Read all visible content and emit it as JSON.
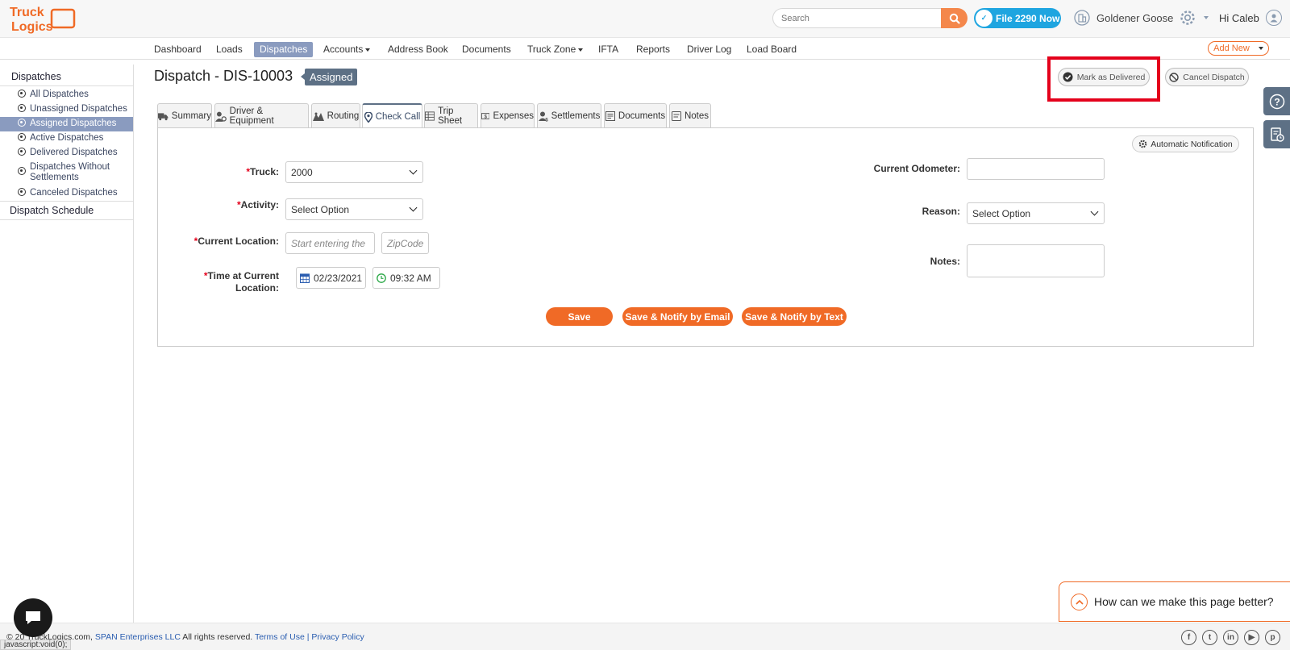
{
  "header": {
    "logo_text_1": "Truck",
    "logo_text_2": "Logics",
    "search_placeholder": "Search",
    "file_btn_label": "File 2290 Now",
    "file_btn_badge": "2290",
    "company_name": "Goldener Goose",
    "user_greeting": "Hi Caleb"
  },
  "nav": {
    "items": [
      {
        "label": "Dashboard"
      },
      {
        "label": "Loads"
      },
      {
        "label": "Dispatches"
      },
      {
        "label": "Accounts"
      },
      {
        "label": "Address Book"
      },
      {
        "label": "Documents"
      },
      {
        "label": "Truck Zone"
      },
      {
        "label": "IFTA"
      },
      {
        "label": "Reports"
      },
      {
        "label": "Driver Log"
      },
      {
        "label": "Load Board"
      }
    ],
    "add_new_label": "Add New"
  },
  "sidebar": {
    "heading": "Dispatches",
    "items": [
      {
        "label": "All Dispatches"
      },
      {
        "label": "Unassigned Dispatches"
      },
      {
        "label": "Assigned Dispatches"
      },
      {
        "label": "Active Dispatches"
      },
      {
        "label": "Delivered Dispatches"
      },
      {
        "label": "Dispatches Without Settlements"
      },
      {
        "label": "Canceled Dispatches"
      }
    ],
    "schedule_label": "Dispatch Schedule"
  },
  "page": {
    "title": "Dispatch - DIS-10003",
    "status": "Assigned",
    "mark_delivered_label": "Mark as Delivered",
    "cancel_dispatch_label": "Cancel Dispatch"
  },
  "tabs": [
    {
      "label": "Summary"
    },
    {
      "label": "Driver & Equipment"
    },
    {
      "label": "Routing"
    },
    {
      "label": "Check Call"
    },
    {
      "label": "Trip Sheet"
    },
    {
      "label": "Expenses"
    },
    {
      "label": "Settlements"
    },
    {
      "label": "Documents"
    },
    {
      "label": "Notes"
    }
  ],
  "form": {
    "auto_notification_label": "Automatic Notification",
    "required_mark": "*",
    "truck_label": "Truck:",
    "truck_value": "2000",
    "activity_label": "Activity:",
    "activity_value": "Select Option",
    "location_label": "Current Location:",
    "location_placeholder": "Start entering the",
    "zip_placeholder": "ZipCode",
    "time_label_1": "Time at Current",
    "time_label_2": "Location:",
    "date_value": "02/23/2021",
    "time_value": "09:32 AM",
    "odometer_label": "Current Odometer:",
    "odometer_value": "",
    "reason_label": "Reason:",
    "reason_value": "Select Option",
    "notes_label": "Notes:",
    "notes_value": "",
    "save_label": "Save",
    "save_email_label": "Save & Notify by Email",
    "save_text_label": "Save & Notify by Text"
  },
  "feedback": {
    "label": "How can we make this page better?"
  },
  "footer": {
    "copyright": "© 20",
    "site": "TruckLogics.com,",
    "company_link": "SPAN Enterprises LLC",
    "rights": "All rights reserved.",
    "terms_label": "Terms of Use",
    "separator": "|",
    "privacy_label": "Privacy Policy",
    "status_url": "javascript:void(0);"
  },
  "colors": {
    "brand_orange": "#f06a26",
    "nav_active": "#8a9bbf",
    "badge_blue": "#1ea5e0",
    "highlight_red": "#e4001b"
  }
}
